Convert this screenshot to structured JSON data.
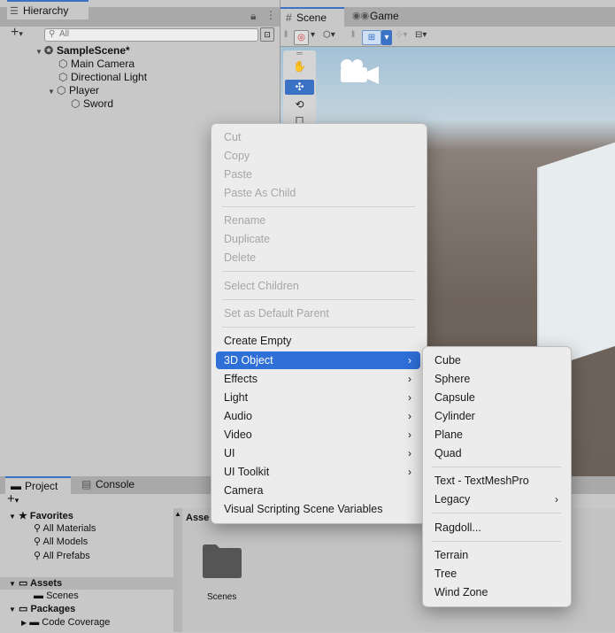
{
  "hierarchy": {
    "tab_label": "Hierarchy",
    "search_placeholder": "All",
    "tree": [
      "SampleScene*",
      "Main Camera",
      "Directional Light",
      "Player",
      "Sword"
    ]
  },
  "scene": {
    "tabs": [
      "Scene",
      "Game"
    ]
  },
  "project": {
    "tabs": [
      "Project",
      "Console"
    ],
    "sidebar": [
      "Favorites",
      "All Materials",
      "All Models",
      "All Prefabs",
      "Assets",
      "Scenes",
      "Packages",
      "Code Coverage"
    ],
    "path_label": "Asse",
    "folder_label": "Scenes"
  },
  "context_menu": {
    "items": [
      "Cut",
      "Copy",
      "Paste",
      "Paste As Child",
      "Rename",
      "Duplicate",
      "Delete",
      "Select Children",
      "Set as Default Parent",
      "Create Empty",
      "3D Object",
      "Effects",
      "Light",
      "Audio",
      "Video",
      "UI",
      "UI Toolkit",
      "Camera",
      "Visual Scripting Scene Variables"
    ],
    "selected": "3D Object"
  },
  "submenu": {
    "items": [
      "Cube",
      "Sphere",
      "Capsule",
      "Cylinder",
      "Plane",
      "Quad",
      "Text - TextMeshPro",
      "Legacy",
      "Ragdoll...",
      "Terrain",
      "Tree",
      "Wind Zone"
    ]
  },
  "colors": {
    "accent": "#2e6fd8",
    "tab_highlight": "#3a72c5",
    "disabled_text": "#a6a6a6"
  }
}
